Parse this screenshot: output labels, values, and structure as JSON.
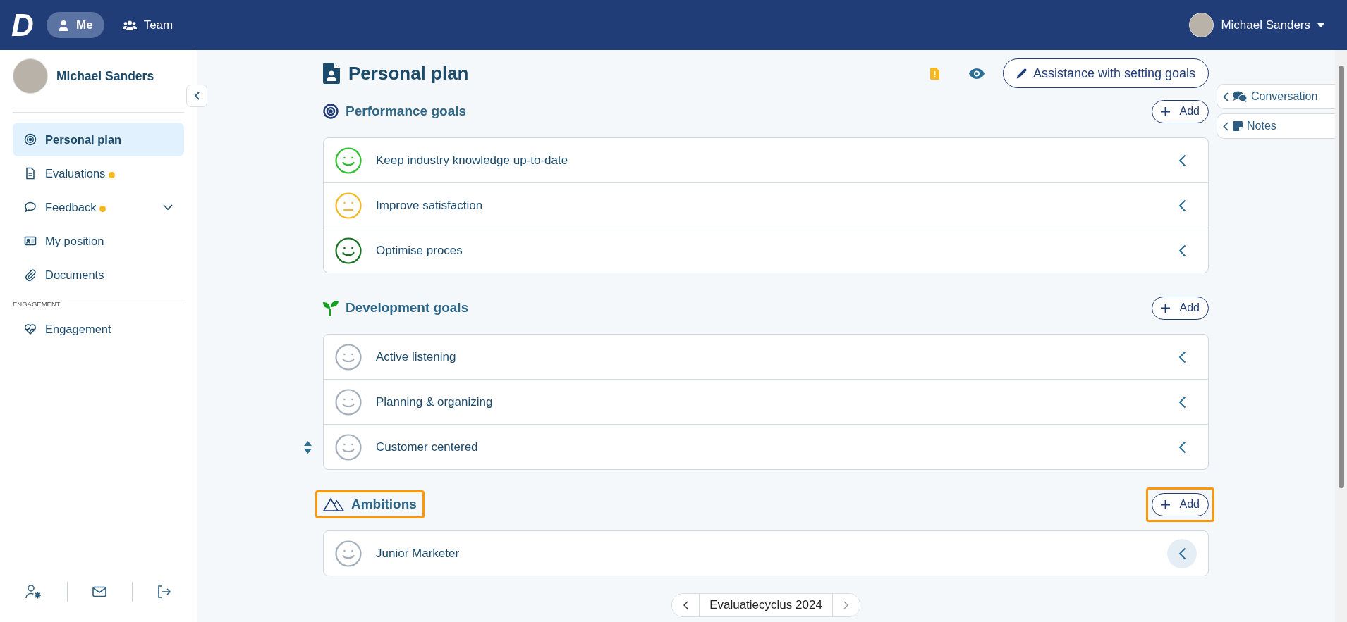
{
  "top_bar": {
    "logo": "D",
    "tabs": [
      {
        "label": "Me",
        "selected": true
      },
      {
        "label": "Team",
        "selected": false
      }
    ],
    "user": {
      "name": "Michael Sanders"
    }
  },
  "sidebar": {
    "user": {
      "name": "Michael Sanders"
    },
    "items": [
      {
        "label": "Personal plan",
        "selected": true,
        "badge": false
      },
      {
        "label": "Evaluations",
        "selected": false,
        "badge": true
      },
      {
        "label": "Feedback",
        "selected": false,
        "badge": true,
        "expandable": true
      },
      {
        "label": "My position",
        "selected": false,
        "badge": false
      },
      {
        "label": "Documents",
        "selected": false,
        "badge": false
      }
    ],
    "section_label": "ENGAGEMENT",
    "section_items": [
      {
        "label": "Engagement",
        "selected": false,
        "badge": false
      }
    ]
  },
  "page": {
    "title": "Personal plan",
    "assist_button": "Assistance with setting goals",
    "sections": [
      {
        "title": "Performance goals",
        "highlighted": false,
        "add_label": "Add",
        "add_highlighted": false,
        "goals": [
          {
            "title": "Keep industry knowledge up-to-date",
            "kind": "smile",
            "color": "#2fbf2f",
            "handle": false,
            "hovered": false
          },
          {
            "title": "Improve satisfaction",
            "kind": "neutral",
            "color": "#f7b81e",
            "handle": false,
            "hovered": false
          },
          {
            "title": "Optimise proces",
            "kind": "smile",
            "color": "#16731f",
            "handle": false,
            "hovered": false
          }
        ]
      },
      {
        "title": "Development goals",
        "highlighted": false,
        "add_label": "Add",
        "add_highlighted": false,
        "goals": [
          {
            "title": "Active listening",
            "kind": "smile",
            "color": "#a3afbb",
            "handle": false,
            "hovered": false
          },
          {
            "title": "Planning & organizing",
            "kind": "smile",
            "color": "#a3afbb",
            "handle": false,
            "hovered": false
          },
          {
            "title": "Customer centered",
            "kind": "smile",
            "color": "#a3afbb",
            "handle": true,
            "hovered": false
          }
        ]
      },
      {
        "title": "Ambitions",
        "highlighted": true,
        "add_label": "Add",
        "add_highlighted": true,
        "goals": [
          {
            "title": "Junior Marketer",
            "kind": "smile",
            "color": "#a3afbb",
            "handle": false,
            "hovered": true
          }
        ]
      }
    ],
    "cycle": "Evaluatiecyclus 2024"
  },
  "side_tabs": [
    {
      "label": "Conversation"
    },
    {
      "label": "Notes"
    }
  ]
}
